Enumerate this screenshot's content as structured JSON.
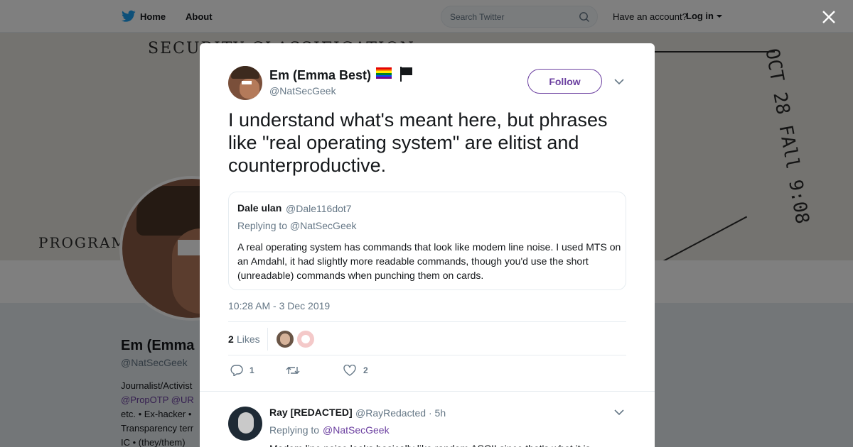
{
  "nav": {
    "home": "Home",
    "about": "About",
    "search_placeholder": "Search Twitter",
    "have_account": "Have an account?",
    "login": "Log in"
  },
  "background": {
    "banner_text_top": "SECURITY CLASSIFICATION",
    "banner_text_left": "PROGRAM",
    "banner_stamp": "OCT 28 FAll 9:08",
    "profile_name": "Em (Emma",
    "profile_handle": "@NatSecGeek",
    "bio_line1": "Journalist/Activist",
    "bio_line2": "@PropOTP @UR",
    "bio_line3": "etc. • Ex-hacker •",
    "bio_line4": "Transparency terr",
    "bio_line5": "IC • (they/them)"
  },
  "tweet": {
    "author_name": "Em (Emma Best)",
    "author_handle": "@NatSecGeek",
    "follow_label": "Follow",
    "text": "I understand what's meant here, but phrases like \"real operating system\" are elitist and counterproductive.",
    "quote": {
      "name": "Dale ulan",
      "handle": "@Dale116dot7",
      "replying": "Replying to @NatSecGeek",
      "text": "A real operating system has commands that look like modem line noise. I used MTS on an Amdahl, it had slightly more readable commands, though you'd use the short (unreadable) commands when punching them on cards."
    },
    "timestamp": "10:28 AM - 3 Dec 2019",
    "likes_count": "2",
    "likes_label": "Likes",
    "reply_count": "1",
    "like_count": "2"
  },
  "reply": {
    "name": "Ray [REDACTED]",
    "handle": "@RayRedacted",
    "time": "· 5h",
    "replying_prefix": "Replying to",
    "replying_to": "@NatSecGeek",
    "text": "Modem line noise looks basically like random ASCII since that's what it is..."
  },
  "colors": {
    "accent": "#6b3fa0",
    "twitter_blue": "#1da1f2",
    "muted": "#657786"
  }
}
